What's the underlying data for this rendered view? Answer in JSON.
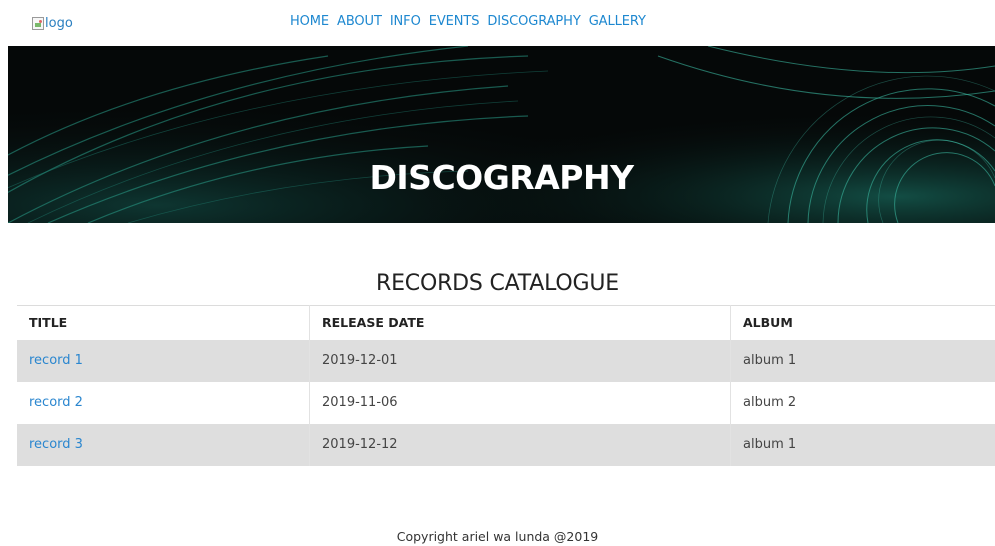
{
  "header": {
    "logo_alt": "logo",
    "nav": [
      {
        "label": "HOME"
      },
      {
        "label": "ABOUT"
      },
      {
        "label": "INFO"
      },
      {
        "label": "EVENTS"
      },
      {
        "label": "DISCOGRAPHY"
      },
      {
        "label": "GALLERY"
      }
    ]
  },
  "hero": {
    "title": "DISCOGRAPHY"
  },
  "catalogue": {
    "heading": "RECORDS CATALOGUE",
    "columns": [
      "TITLE",
      "RELEASE DATE",
      "ALBUM"
    ],
    "rows": [
      {
        "title": "record 1",
        "release_date": "2019-12-01",
        "album": "album 1"
      },
      {
        "title": "record 2",
        "release_date": "2019-11-06",
        "album": "album 2"
      },
      {
        "title": "record 3",
        "release_date": "2019-12-12",
        "album": "album 1"
      }
    ]
  },
  "footer": {
    "text": "Copyright ariel wa lunda @2019"
  },
  "colors": {
    "link": "#1e88d0",
    "hero_bg": "#050808",
    "hero_accent": "#1f8c7a",
    "row_shade": "#dedede"
  }
}
